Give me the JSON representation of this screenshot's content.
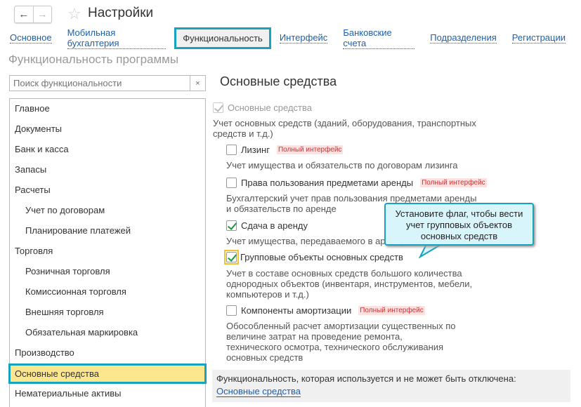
{
  "header": {
    "title": "Настройки",
    "back": "←",
    "forward": "→"
  },
  "tabs": [
    "Основное",
    "Мобильная бухгалтерия",
    "Функциональность",
    "Интерфейс",
    "Банковские счета",
    "Подразделения",
    "Регистрации"
  ],
  "section_title": "Функциональность программы",
  "search": {
    "placeholder": "Поиск функциональности",
    "clear": "×"
  },
  "sidebar": {
    "items": [
      {
        "label": "Главное"
      },
      {
        "label": "Документы"
      },
      {
        "label": "Банк и касса"
      },
      {
        "label": "Запасы"
      },
      {
        "label": "Расчеты"
      },
      {
        "label": "Учет по договорам"
      },
      {
        "label": "Планирование платежей"
      },
      {
        "label": "Торговля"
      },
      {
        "label": "Розничная торговля"
      },
      {
        "label": "Комиссионная торговля"
      },
      {
        "label": "Внешняя торговля"
      },
      {
        "label": "Обязательная маркировка"
      },
      {
        "label": "Производство"
      },
      {
        "label": "Основные средства"
      },
      {
        "label": "Нематериальные активы"
      }
    ]
  },
  "content": {
    "title": "Основные средства",
    "main": {
      "label": "Основные средства",
      "desc1": "Учет основных средств (зданий, оборудования, транспортных",
      "desc2": "средств и т.д.)"
    },
    "options": [
      {
        "label": "Лизинг",
        "badge": "Полный интерфейс",
        "desc": [
          "Учет имущества и обязательств  по договорам лизинга"
        ]
      },
      {
        "label": "Права пользования предметами аренды",
        "badge": "Полный интерфейс",
        "desc": [
          "Бухгалтерский учет прав пользования предметами аренды",
          "и обязательств по аренде"
        ]
      },
      {
        "label": "Сдача в аренду",
        "desc": [
          "Учет имущества, передаваемого в аренду"
        ]
      },
      {
        "label": "Групповые объекты основных средств",
        "desc": [
          "Учет в составе основных средств большого количества",
          "однородных объектов (инвентаря, инструментов, мебели,",
          "компьютеров и т.д.)"
        ]
      },
      {
        "label": "Компоненты амортизации",
        "badge": "Полный интерфейс",
        "desc": [
          "Обособленный расчет амортизации существенных по",
          "величине затрат на проведение ремонта,",
          "технического осмотра, технического обслуживания",
          "основных средств"
        ]
      }
    ],
    "bottom": {
      "text": "Функциональность, которая используется и не может быть отключена:",
      "link": "Основные средства"
    }
  },
  "callout": {
    "line1": "Установите флаг, чтобы вести",
    "line2": "учет групповых объектов",
    "line3": "основных средств"
  }
}
